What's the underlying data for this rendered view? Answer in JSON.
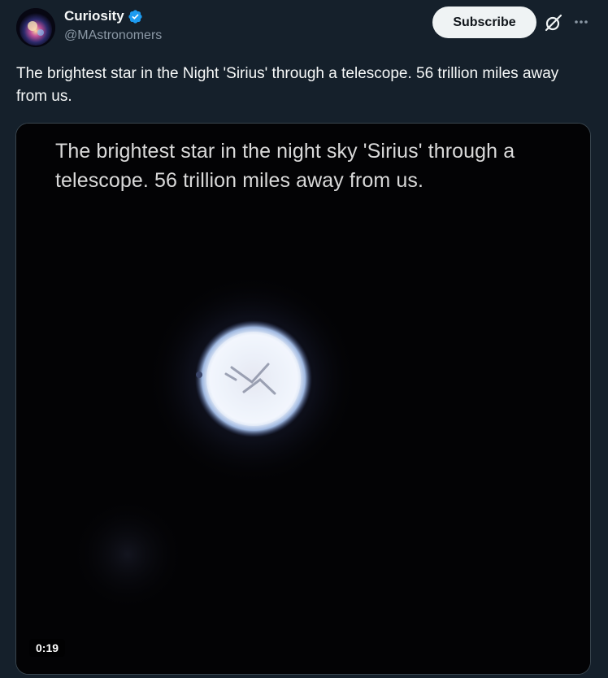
{
  "author": {
    "display_name": "Curiosity",
    "handle": "@MAstronomers",
    "verified": true,
    "avatar_icon": "galaxy-avatar"
  },
  "actions": {
    "subscribe_label": "Subscribe",
    "grok_icon": "grok-icon",
    "more_icon": "more-icon"
  },
  "tweet": {
    "text": "The brightest star in the Night 'Sirius' through a telescope. 56 trillion miles away from us."
  },
  "media": {
    "caption": "The brightest star in the night sky 'Sirius' through a telescope. 56 trillion miles away from us.",
    "duration": "0:19"
  },
  "colors": {
    "background": "#15202b",
    "accent_blue": "#1d9bf0",
    "subscribe_bg": "#eff3f4",
    "secondary_text": "#8b98a5"
  }
}
